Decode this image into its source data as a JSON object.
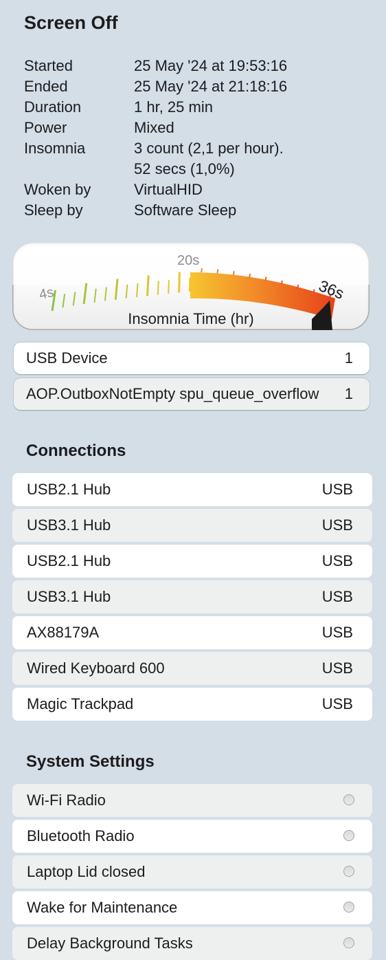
{
  "title": "Screen Off",
  "info": [
    {
      "label": "Started",
      "value": "25 May '24 at 19:53:16"
    },
    {
      "label": "Ended",
      "value": "25 May '24 at 21:18:16"
    },
    {
      "label": "Duration",
      "value": "1 hr, 25 min"
    },
    {
      "label": "Power",
      "value": "Mixed"
    },
    {
      "label": "Insomnia",
      "value": "3 count (2,1 per hour)."
    },
    {
      "label": "",
      "value": "52 secs (1,0%)"
    },
    {
      "label": "Woken by",
      "value": "VirtualHID"
    },
    {
      "label": "Sleep by",
      "value": "Software Sleep"
    }
  ],
  "gauge": {
    "label": "Insomnia Time (hr)",
    "tick_labels": [
      "4s",
      "20s",
      "36s"
    ],
    "min_label": "4s",
    "mid_label": "20s",
    "max_label": "36s",
    "colors": {
      "green": "#8dc43f",
      "yellow": "#f6c531",
      "orange": "#f28a28",
      "red": "#e6421a",
      "needle": "#1a1a1a"
    }
  },
  "reasons": [
    {
      "name": "USB Device",
      "count": "1"
    },
    {
      "name": "AOP.OutboxNotEmpty spu_queue_overflow",
      "count": "1"
    }
  ],
  "connections": {
    "title": "Connections",
    "items": [
      {
        "name": "USB2.1 Hub",
        "type": "USB"
      },
      {
        "name": "USB3.1 Hub",
        "type": "USB"
      },
      {
        "name": "USB2.1 Hub",
        "type": "USB"
      },
      {
        "name": "USB3.1 Hub",
        "type": "USB"
      },
      {
        "name": "AX88179A",
        "type": "USB"
      },
      {
        "name": "Wired Keyboard 600",
        "type": "USB"
      },
      {
        "name": "Magic Trackpad",
        "type": "USB"
      }
    ]
  },
  "system_settings": {
    "title": "System Settings",
    "items": [
      {
        "name": "Wi-Fi Radio",
        "enabled": false
      },
      {
        "name": "Bluetooth Radio",
        "enabled": false
      },
      {
        "name": "Laptop Lid closed",
        "enabled": false
      },
      {
        "name": "Wake for Maintenance",
        "enabled": false
      },
      {
        "name": "Delay Background Tasks",
        "enabled": false
      }
    ]
  }
}
